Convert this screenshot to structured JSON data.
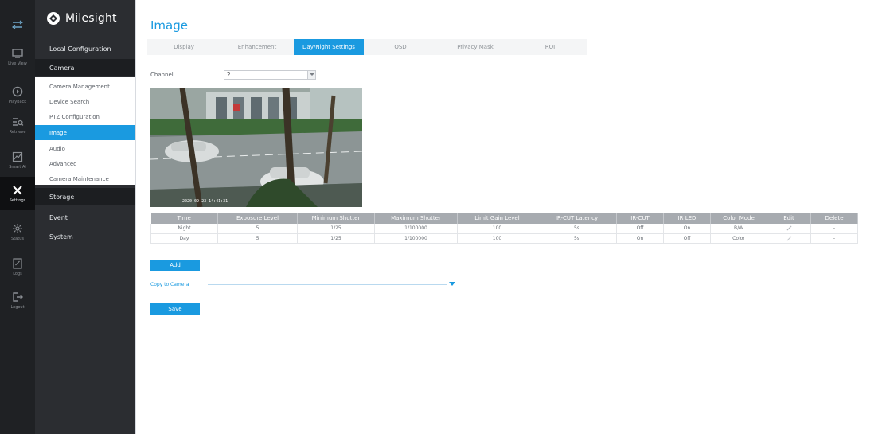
{
  "rail": {
    "items": [
      {
        "label": "",
        "icon": "menu-toggle-icon"
      },
      {
        "label": "Live View",
        "icon": "monitor-icon"
      },
      {
        "label": "Playback",
        "icon": "playback-icon"
      },
      {
        "label": "Retrieve",
        "icon": "retrieve-icon"
      },
      {
        "label": "Smart Ai",
        "icon": "smart-ai-icon"
      },
      {
        "label": "Settings",
        "icon": "settings-icon"
      },
      {
        "label": "Status",
        "icon": "status-icon"
      },
      {
        "label": "Logs",
        "icon": "logs-icon"
      },
      {
        "label": "Logout",
        "icon": "logout-icon"
      }
    ]
  },
  "brand": {
    "name": "Milesight"
  },
  "menu": {
    "local_configuration": "Local Configuration",
    "camera": "Camera",
    "camera_items": [
      "Camera Management",
      "Device Search",
      "PTZ Configuration",
      "Image",
      "Audio",
      "Advanced",
      "Camera Maintenance"
    ],
    "active_item": "Image",
    "storage": "Storage",
    "event": "Event",
    "system": "System"
  },
  "page": {
    "title": "Image",
    "tabs": [
      "Display",
      "Enhancement",
      "Day/Night Settings",
      "OSD",
      "Privacy Mask",
      "ROI"
    ],
    "active_tab": "Day/Night Settings"
  },
  "channel": {
    "label": "Channel",
    "value": "2"
  },
  "preview": {
    "osd_text": "2020-09-23 14:41:31"
  },
  "schedule": {
    "headers": [
      "Time",
      "Exposure Level",
      "Minimum Shutter",
      "Maximum Shutter",
      "Limit Gain Level",
      "IR-CUT Latency",
      "IR-CUT",
      "IR LED",
      "Color Mode",
      "Edit",
      "Delete"
    ],
    "rows": [
      [
        "Night",
        "5",
        "1/25",
        "1/100000",
        "100",
        "5s",
        "Off",
        "On",
        "B/W",
        "",
        "-"
      ],
      [
        "Day",
        "5",
        "1/25",
        "1/100000",
        "100",
        "5s",
        "On",
        "Off",
        "Color",
        "",
        "-"
      ]
    ]
  },
  "buttons": {
    "add": "Add",
    "save": "Save"
  },
  "copy": {
    "label": "Copy to Camera"
  },
  "colors": {
    "accent": "#1a9ae0",
    "rail_bg": "#1f2124",
    "menu_bg": "#2b2d31"
  }
}
